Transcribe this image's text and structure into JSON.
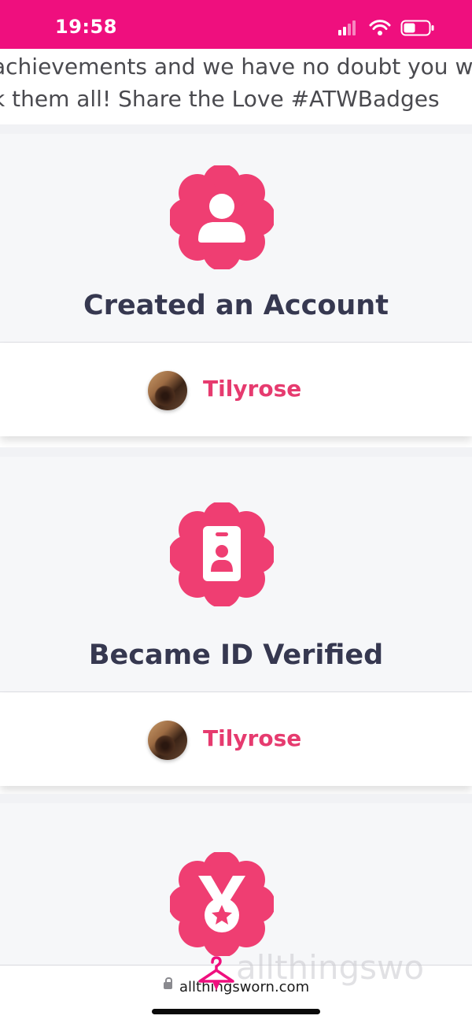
{
  "status_bar": {
    "time": "19:58",
    "icons": [
      "signal-icon",
      "wifi-icon",
      "battery-icon"
    ],
    "background_color": "#ef0f7e"
  },
  "intro": {
    "text_line1": "achievements and we have no doubt you wi",
    "text_line2": "k them all! Share the Love #ATWBadges"
  },
  "badges": [
    {
      "title": "Created an Account",
      "icon": "user-icon",
      "user": "Tilyrose"
    },
    {
      "title": "Became ID Verified",
      "icon": "id-card-icon",
      "user": "Tilyrose"
    },
    {
      "title": "",
      "icon": "medal-icon",
      "user": ""
    }
  ],
  "browser": {
    "url": "allthingsworn.com",
    "watermark": "allthingswo"
  },
  "colors": {
    "accent": "#ef3e72",
    "title_text": "#363850",
    "username": "#e63b6f"
  }
}
